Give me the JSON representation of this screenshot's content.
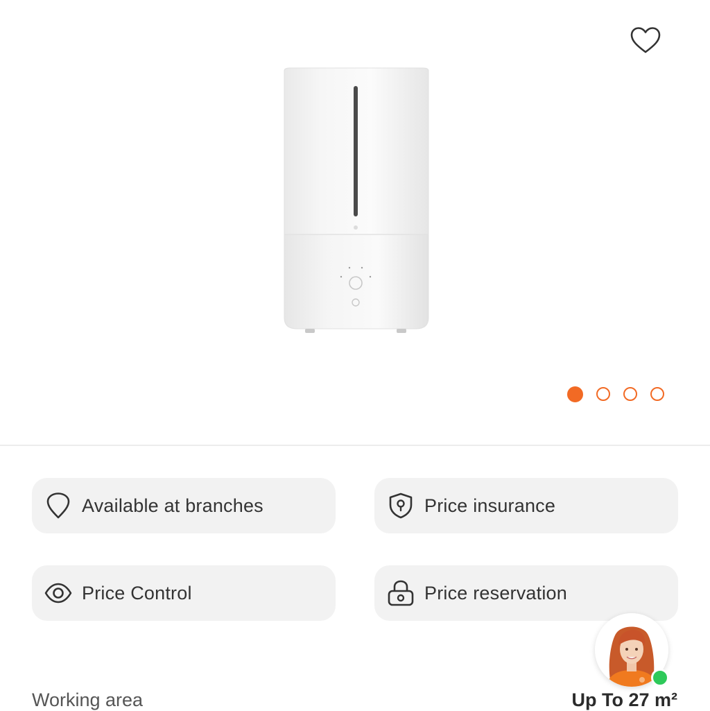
{
  "gallery": {
    "favorite_icon": "heart-outline-icon",
    "image_count": 4,
    "active_index": 0
  },
  "features": [
    {
      "label": "Available at branches",
      "icon": "location-pin-icon"
    },
    {
      "label": "Price insurance",
      "icon": "shield-icon"
    },
    {
      "label": "Price Control",
      "icon": "eye-icon"
    },
    {
      "label": "Price reservation",
      "icon": "lock-icon"
    }
  ],
  "spec": {
    "label": "Working area",
    "value": "Up To 27 m²"
  },
  "support": {
    "status": "online",
    "status_color": "#2ec95a"
  },
  "colors": {
    "accent": "#f26a24",
    "card_bg": "#f2f2f2"
  }
}
